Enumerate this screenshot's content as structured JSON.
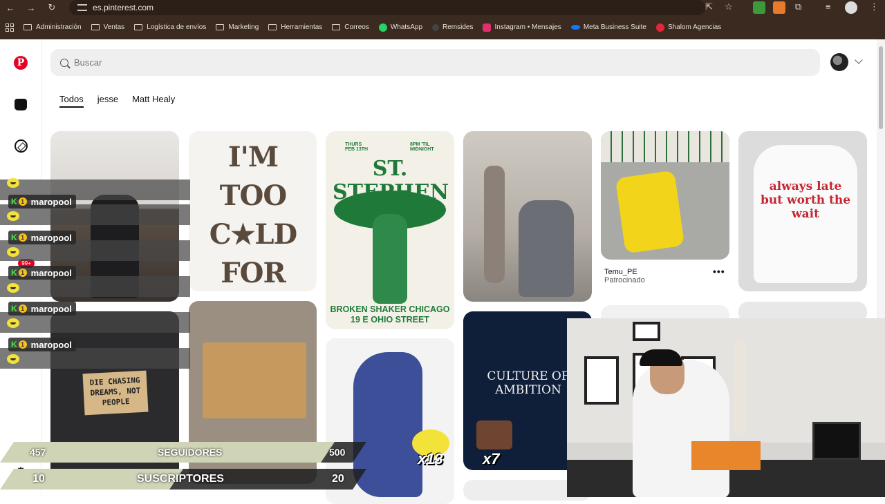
{
  "browser": {
    "url": "es.pinterest.com",
    "bookmarks": [
      {
        "label": "Administración",
        "icon": "folder-icon"
      },
      {
        "label": "Ventas",
        "icon": "folder-icon"
      },
      {
        "label": "Logística de envíos",
        "icon": "folder-icon"
      },
      {
        "label": "Marketing",
        "icon": "folder-icon"
      },
      {
        "label": "Herramientas",
        "icon": "folder-icon"
      },
      {
        "label": "Correos",
        "icon": "folder-icon"
      },
      {
        "label": "WhatsApp",
        "icon": "whatsapp-icon",
        "color": "#25d366"
      },
      {
        "label": "Remsides",
        "icon": "remsides-icon",
        "color": "#444444"
      },
      {
        "label": "Instagram • Mensajes",
        "icon": "instagram-icon",
        "color": "#e1306c"
      },
      {
        "label": "Meta Business Suite",
        "icon": "meta-icon",
        "color": "#1877f2"
      },
      {
        "label": "Shalom Agencias",
        "icon": "shalom-icon",
        "color": "#e5263a"
      }
    ]
  },
  "pinterest": {
    "brand_color": "#e60023",
    "search_placeholder": "Buscar",
    "tabs": [
      "Todos",
      "jesse",
      "Matt Healy"
    ],
    "pins": {
      "p2_text": "I'M TOO C★LD FOR YOU!",
      "p3_title": "ST. STEPHEN",
      "p3_date_left": "THURS FEB 13TH",
      "p3_date_right": "8PM 'TIL MIDNIGHT",
      "p3_footer": "BROKEN SHAKER CHICAGO 19 E OHIO STREET",
      "p6_text": "always late but worth the wait",
      "p7_sign": "DIE CHASING DREAMS, NOT PEOPLE",
      "p10_text": "CULTURE OF AMBITION",
      "sponsored_title": "Temu_PE",
      "sponsored_sub": "Patrocinado",
      "more_label": "•••"
    }
  },
  "stream": {
    "chat": [
      {
        "user": "maropool",
        "badge": "1"
      },
      {
        "user": "maropool",
        "badge": "1"
      },
      {
        "user": "maropool",
        "badge": "1"
      },
      {
        "user": "maropool",
        "badge": "1"
      },
      {
        "user": "maropool",
        "badge": "1"
      }
    ],
    "k_label": "K",
    "notif_badge": "99+",
    "followers": {
      "label": "SEGUIDORES",
      "current": "457",
      "goal": "500",
      "progress": 0.914
    },
    "subscribers": {
      "label": "SUSCRIPTORES",
      "current": "10",
      "goal": "20",
      "progress": 0.5
    },
    "emote_counts": [
      "x13",
      "x7"
    ]
  }
}
